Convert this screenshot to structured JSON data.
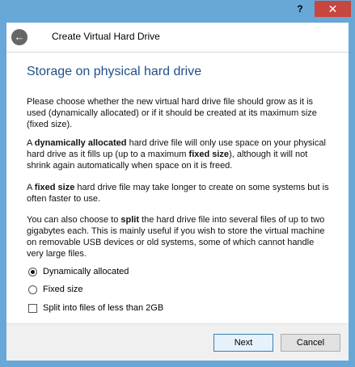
{
  "window": {
    "help_label": "?",
    "close_label": "✕",
    "title": "Create Virtual Hard Drive",
    "back_label": "←"
  },
  "page": {
    "heading": "Storage on physical hard drive",
    "p1": "Please choose whether the new virtual hard drive file should grow as it is used (dynamically allocated) or if it should be created at its maximum size (fixed size).",
    "p2_a": "A ",
    "p2_b": "dynamically allocated",
    "p2_c": " hard drive file will only use space on your physical hard drive as it fills up (up to a maximum ",
    "p2_d": "fixed size",
    "p2_e": "), although it will not shrink again automatically when space on it is freed.",
    "p3_a": "A ",
    "p3_b": "fixed size",
    "p3_c": " hard drive file may take longer to create on some systems but is often faster to use.",
    "p4_a": "You can also choose to ",
    "p4_b": "split",
    "p4_c": " the hard drive file into several files of up to two gigabytes each. This is mainly useful if you wish to store the virtual machine on removable USB devices or old systems, some of which cannot handle very large files.",
    "options": [
      {
        "label": "Dynamically allocated",
        "checked": true
      },
      {
        "label": "Fixed size",
        "checked": false
      }
    ],
    "split_label": "Split into files of less than 2GB",
    "split_checked": false
  },
  "buttons": {
    "next": "Next",
    "cancel": "Cancel"
  },
  "colors": {
    "frame": "#67a8d8",
    "close": "#c7463e",
    "heading": "#1f4f8a"
  }
}
